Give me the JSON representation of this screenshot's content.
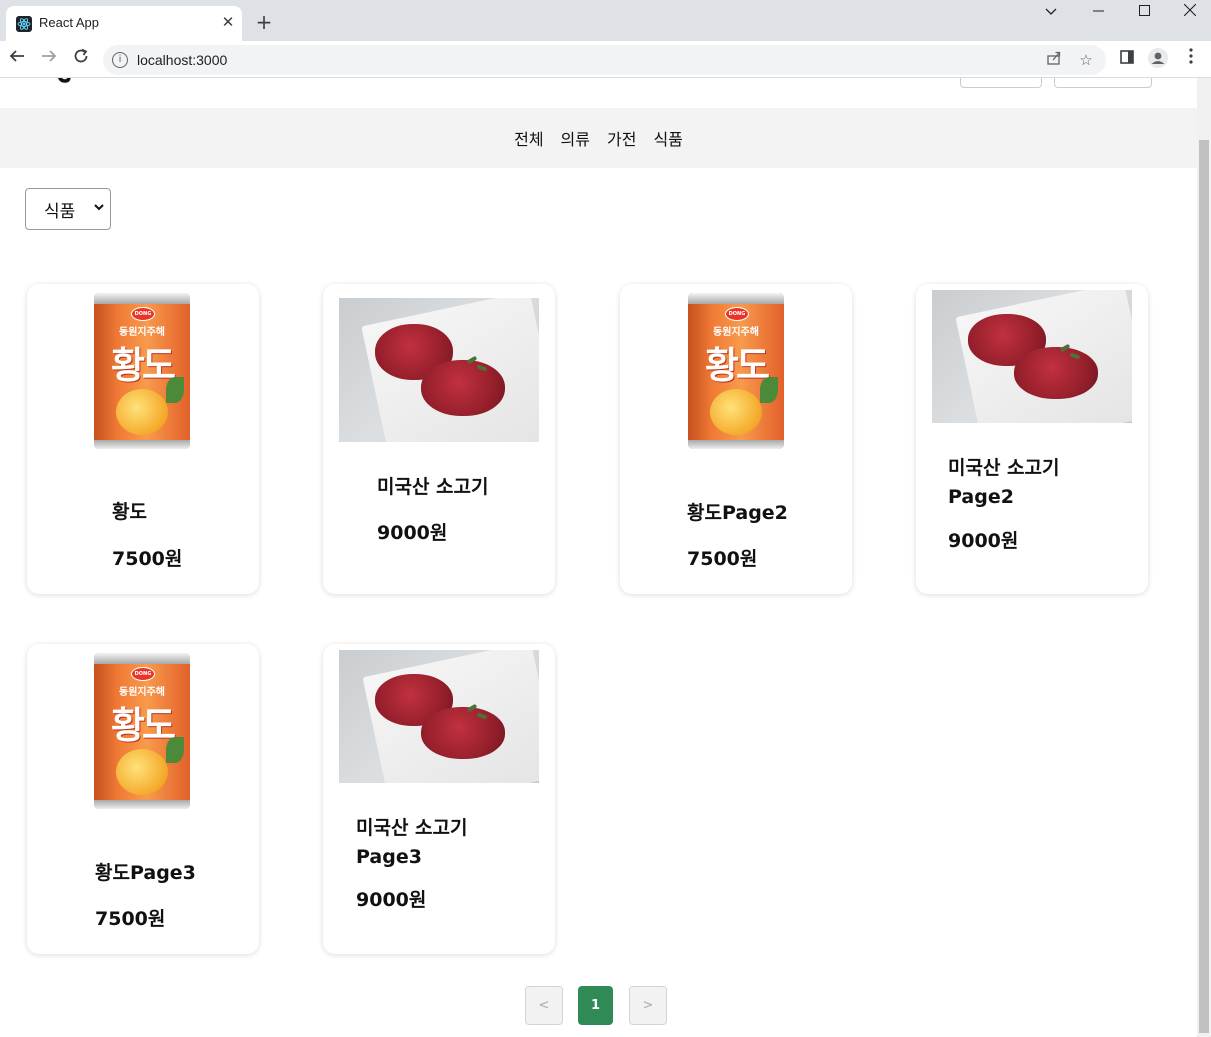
{
  "browser": {
    "tab_title": "React App",
    "url": "localhost:3000"
  },
  "categories": [
    "전체",
    "의류",
    "가전",
    "식품"
  ],
  "filter": {
    "selected": "식품"
  },
  "products": [
    {
      "name": "황도",
      "price": "7500원",
      "image": "canned-peach"
    },
    {
      "name": "미국산 소고기",
      "price": "9000원",
      "image": "beef-steak"
    },
    {
      "name": "황도Page2",
      "price": "7500원",
      "image": "canned-peach"
    },
    {
      "name": "미국산 소고기 Page2",
      "price": "9000원",
      "image": "beef-steak"
    },
    {
      "name": "황도Page3",
      "price": "7500원",
      "image": "canned-peach"
    },
    {
      "name": "미국산 소고기 Page3",
      "price": "9000원",
      "image": "beef-steak"
    }
  ],
  "pagination": {
    "prev": "<",
    "current": "1",
    "next": ">"
  }
}
